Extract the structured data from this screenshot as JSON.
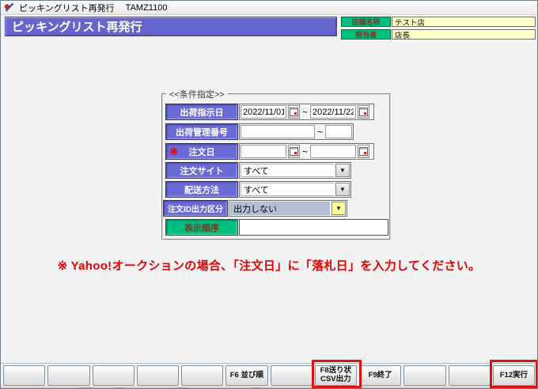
{
  "window": {
    "title": "ピッキングリスト再発行",
    "code": "TAMZ1100"
  },
  "header": {
    "title": "ピッキングリスト再発行",
    "store": {
      "label": "店舗名称",
      "value": "テスト店"
    },
    "manager": {
      "label": "担当者",
      "value": "店長"
    }
  },
  "conditions": {
    "group_title": "<<条件指定>>",
    "range_separator": "~",
    "required_mark": "※",
    "ship_date": {
      "label": "出荷指示日",
      "from": "2022/11/01",
      "to": "2022/11/22"
    },
    "ship_no": {
      "label": "出荷管理番号",
      "from": "",
      "to": ""
    },
    "order_date": {
      "label": "注文日",
      "from": "",
      "to": ""
    },
    "order_site": {
      "label": "注文サイト",
      "value": "すべて"
    },
    "delivery_method": {
      "label": "配送方法",
      "value": "すべて"
    },
    "order_id_output": {
      "label": "注文ID出力区分",
      "value": "出力しない"
    },
    "display_order": {
      "label": "表示順序",
      "value": ""
    }
  },
  "note": "※ Yahoo!オークションの場合、「注文日」に「落札日」を入力してください。",
  "function_bar": {
    "buttons": [
      {
        "key": "f1",
        "label": ""
      },
      {
        "key": "f2",
        "label": ""
      },
      {
        "key": "f3",
        "label": ""
      },
      {
        "key": "f4",
        "label": ""
      },
      {
        "key": "f5",
        "label": ""
      },
      {
        "key": "f6",
        "label": "F6 並び順"
      },
      {
        "key": "f7",
        "label": ""
      },
      {
        "key": "f8",
        "label": "F8送り状\nCSV出力",
        "highlighted": true
      },
      {
        "key": "f9",
        "label": "F9終了"
      },
      {
        "key": "f10",
        "label": ""
      },
      {
        "key": "f11",
        "label": ""
      },
      {
        "key": "f12",
        "label": "F12実行",
        "highlighted": true
      }
    ]
  },
  "colors": {
    "header_blue": "#6565cd",
    "label_blue": "#6b6bd8",
    "label_green": "#00be7d",
    "field_yellow": "#ffffcc",
    "readonly_combo_bg": "#b2c0d4",
    "combo_arrow_yellow": "#ffff99",
    "note_red": "#e60000",
    "highlight_red": "#e01010"
  }
}
